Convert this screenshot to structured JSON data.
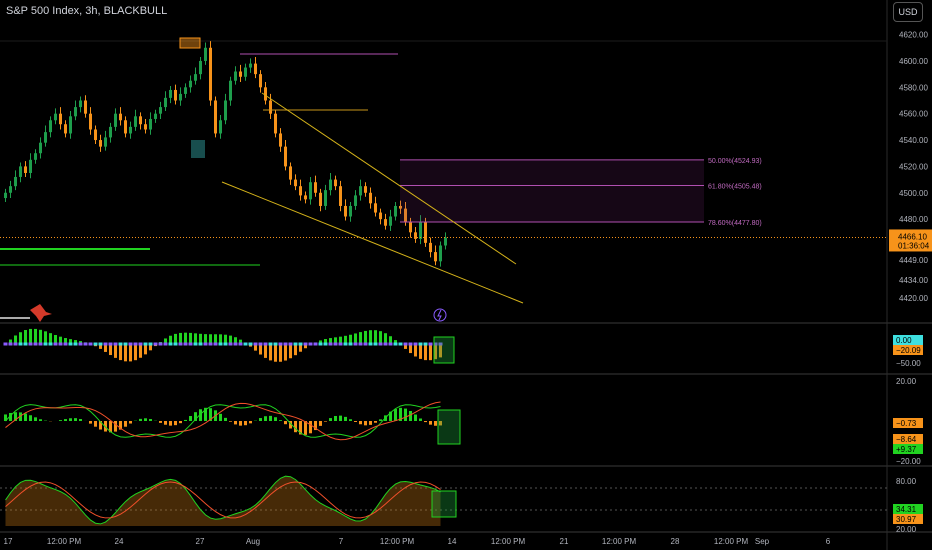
{
  "header": {
    "title": "S&P 500 Index, 3h, BLACKBULL",
    "currency_button": "USD"
  },
  "colors": {
    "background": "#000000",
    "bull": "#1e9e4c",
    "bear": "#f7931a",
    "fib": "#b04fb0",
    "trendline": "#d4b21a",
    "green_line": "#21d321",
    "grid": "#1f1f1f"
  },
  "chart_data": [
    {
      "type": "candlestick",
      "ylim": [
        4405,
        4625
      ],
      "y_ticks": [
        4620,
        4600,
        4580,
        4560,
        4540,
        4520,
        4500,
        4480,
        4449,
        4434,
        4420
      ],
      "y_tick_labels": [
        "4620.00",
        "4600.00",
        "4580.00",
        "4560.00",
        "4540.00",
        "4520.00",
        "4500.00",
        "4480.00",
        "4449.00",
        "4434.00",
        "4420.00"
      ],
      "x_tick_labels": [
        "17",
        "12:00 PM",
        "24",
        "27",
        "Aug",
        "7",
        "12:00 PM",
        "14",
        "12:00 PM",
        "21",
        "12:00 PM",
        "28",
        "12:00 PM",
        "Sep",
        "6"
      ],
      "price_label": "4466.10",
      "price_timer": "01:36:04",
      "price_level": 4466.1,
      "fib_levels": [
        {
          "label": "50.00%(4524.93)",
          "price": 4524.93
        },
        {
          "label": "61.80%(4505.48)",
          "price": 4505.48
        },
        {
          "label": "78.60%(4477.80)",
          "price": 4477.8
        }
      ],
      "closes": [
        4500,
        4505,
        4512,
        4520,
        4515,
        4525,
        4530,
        4538,
        4546,
        4555,
        4560,
        4552,
        4545,
        4558,
        4565,
        4570,
        4560,
        4548,
        4540,
        4535,
        4542,
        4550,
        4560,
        4555,
        4545,
        4550,
        4558,
        4552,
        4548,
        4556,
        4560,
        4565,
        4572,
        4578,
        4570,
        4575,
        4580,
        4585,
        4590,
        4600,
        4610,
        4570,
        4545,
        4555,
        4570,
        4585,
        4592,
        4588,
        4595,
        4598,
        4590,
        4580,
        4570,
        4560,
        4545,
        4535,
        4520,
        4510,
        4505,
        4498,
        4495,
        4508,
        4500,
        4490,
        4502,
        4510,
        4505,
        4490,
        4482,
        4490,
        4498,
        4505,
        4500,
        4492,
        4485,
        4480,
        4475,
        4482,
        4490,
        4488,
        4478,
        4470,
        4465,
        4478,
        4462,
        4455,
        4448,
        4460,
        4466
      ]
    },
    {
      "type": "histogram",
      "name": "indicator-1",
      "labels": [
        "0.00",
        "−20.09",
        "−50.00"
      ]
    },
    {
      "type": "line",
      "name": "indicator-2",
      "labels": [
        "20.00",
        "−0.73",
        "−8.64",
        "+9.37",
        "−20.00"
      ]
    },
    {
      "type": "line",
      "name": "indicator-3",
      "labels": [
        "80.00",
        "34.31",
        "30.97",
        "20.00"
      ]
    }
  ]
}
